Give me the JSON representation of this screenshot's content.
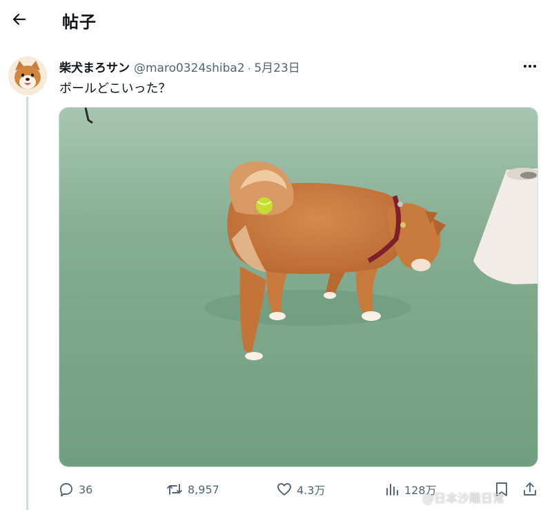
{
  "header": {
    "back_icon": "arrow-left-icon",
    "title": "帖子"
  },
  "post": {
    "author_name": "柴犬まろサン",
    "handle": "@maro0324shiba2",
    "separator": "·",
    "date": "5月23日",
    "more_icon": "more-horizontal-icon",
    "text": "ボールどこいった？",
    "media_description_icon": "photo-shiba-inu-with-tennis-ball"
  },
  "actions": {
    "reply": {
      "icon": "reply-icon",
      "count": "36"
    },
    "repost": {
      "icon": "repost-icon",
      "count": "8,957"
    },
    "like": {
      "icon": "heart-icon",
      "count": "4.3万"
    },
    "views": {
      "icon": "views-chart-icon",
      "count": "128万"
    },
    "bookmark": {
      "icon": "bookmark-icon"
    },
    "share": {
      "icon": "share-icon"
    }
  },
  "watermark": {
    "text": "@日本沙雕日常"
  },
  "colors": {
    "text_primary": "#0f1419",
    "text_secondary": "#536471",
    "divider": "#cfd9de",
    "court_green": "#7fa98a",
    "dog_fur": "#c8763e"
  }
}
